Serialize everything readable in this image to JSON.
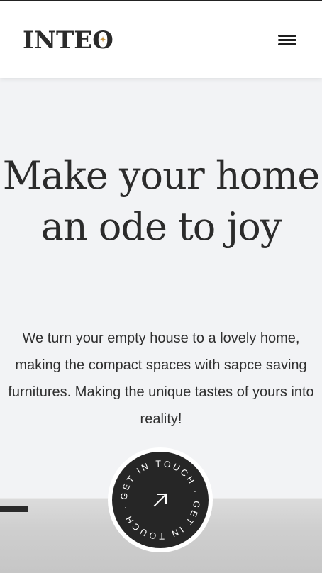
{
  "header": {
    "logo_prefix": "INT",
    "logo_e": "E",
    "logo_o": "O",
    "logo_spark": "✦",
    "menu_icon": "hamburger-menu-icon"
  },
  "hero": {
    "title": "Make your home an ode to joy",
    "text": "We turn your empty house to a lovely home, making the compact spaces with sapce saving furnitures. Making the unique tastes of yours into reality!"
  },
  "cta": {
    "circle_text": "GET IN TOUCH · GET IN TOUCH · ",
    "icon": "arrow-up-right-icon"
  },
  "colors": {
    "background": "#f2f3f5",
    "header": "#ffffff",
    "text": "#2b2b2b",
    "cta": "#262626",
    "accent": "#c8933c"
  }
}
